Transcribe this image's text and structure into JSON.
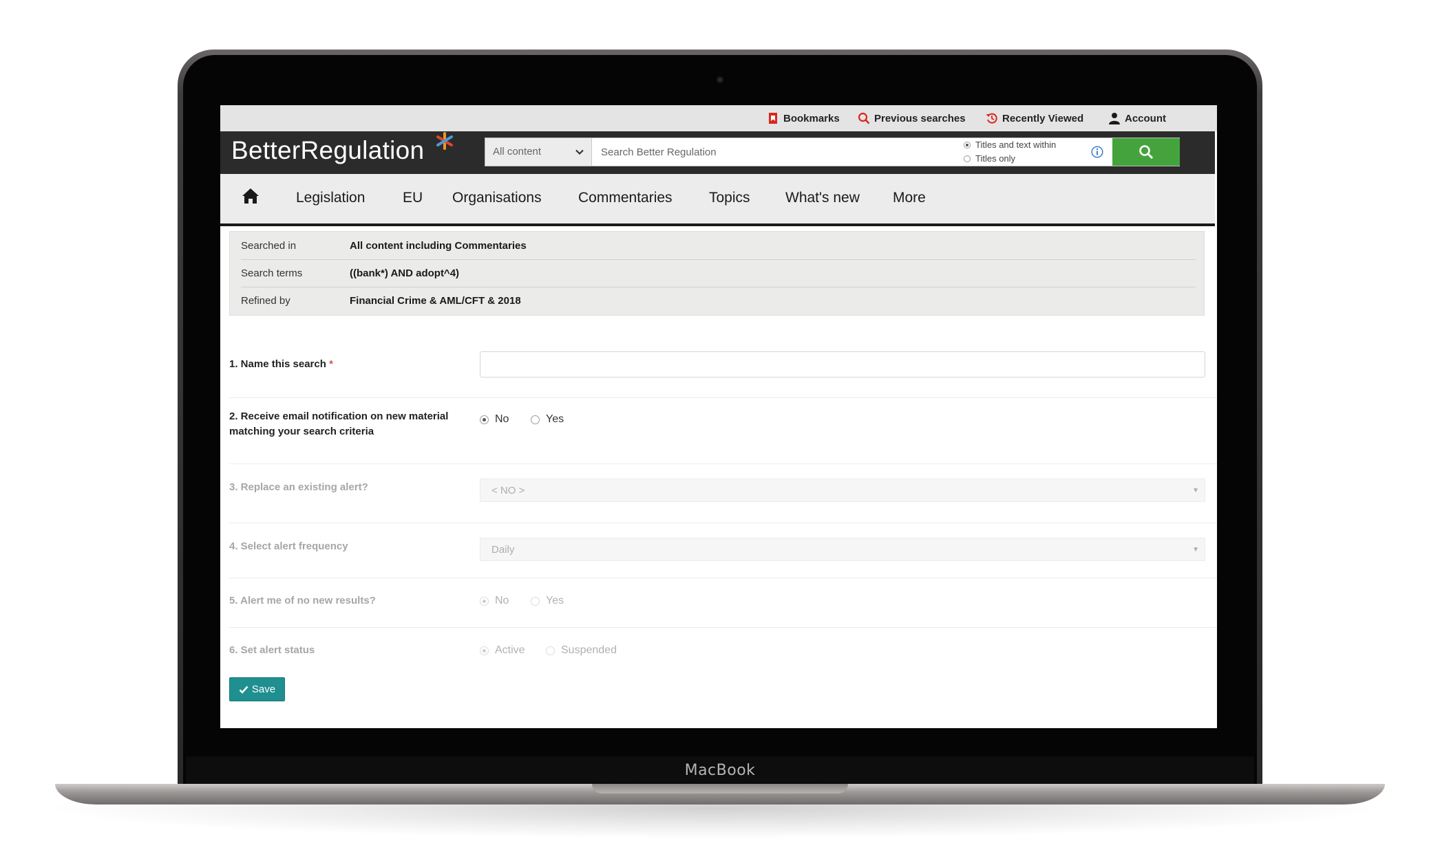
{
  "device": {
    "brand": "MacBook"
  },
  "utility_nav": [
    {
      "label": "Bookmarks",
      "icon": "bookmark-icon"
    },
    {
      "label": "Previous searches",
      "icon": "search-history-icon"
    },
    {
      "label": "Recently Viewed",
      "icon": "history-icon"
    },
    {
      "label": "Account",
      "icon": "user-icon"
    }
  ],
  "header": {
    "logo_text": "BetterRegulation",
    "logo_star_color": "#f0942b",
    "search": {
      "scope": "All content",
      "placeholder": "Search Better Regulation",
      "mode_options": [
        {
          "label": "Titles and text within",
          "selected": true
        },
        {
          "label": "Titles only",
          "selected": false
        }
      ],
      "button_color": "#45a33e"
    }
  },
  "main_nav": [
    "Legislation",
    "EU",
    "Organisations",
    "Commentaries",
    "Topics",
    "What's new",
    "More"
  ],
  "summary": [
    {
      "label": "Searched in",
      "value": "All content including Commentaries"
    },
    {
      "label": "Search terms",
      "value": "((bank*) AND adopt^4)"
    },
    {
      "label": "Refined by",
      "value": "Financial Crime & AML/CFT & 2018"
    }
  ],
  "form": {
    "name_label": "1. Name this search",
    "required_mark": "*",
    "name_value": "",
    "email_label_line1": "2. Receive email notification on new material",
    "email_label_line2": "matching your search criteria",
    "email_options": [
      {
        "label": "No",
        "selected": true
      },
      {
        "label": "Yes",
        "selected": false
      }
    ],
    "replace_label": "3. Replace an existing alert?",
    "replace_value": "< NO >",
    "frequency_label": "4. Select alert frequency",
    "frequency_value": "Daily",
    "no_results_label": "5. Alert me of no new results?",
    "no_results_options": [
      {
        "label": "No",
        "selected": true
      },
      {
        "label": "Yes",
        "selected": false
      }
    ],
    "status_label": "6. Set alert status",
    "status_options": [
      {
        "label": "Active",
        "selected": true
      },
      {
        "label": "Suspended",
        "selected": false
      }
    ],
    "save_label": "Save",
    "save_color": "#1f8f90"
  }
}
